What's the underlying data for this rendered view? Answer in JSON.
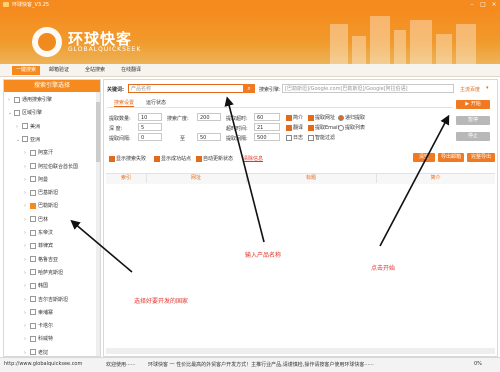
{
  "window": {
    "title": "环球快客_V3.25",
    "min": "–",
    "max": "□",
    "close": "×"
  },
  "header": {
    "logo_cn": "环球快客",
    "logo_en": "GLOBALQUICKSEEK"
  },
  "menu": [
    {
      "label": "一键搜索",
      "active": true
    },
    {
      "label": "邮箱验证",
      "active": false
    },
    {
      "label": "全站搜索",
      "active": false
    },
    {
      "label": "在线翻译",
      "active": false
    }
  ],
  "left_panel": {
    "title": "搜索引擎选择",
    "items": [
      {
        "label": "通用搜索引擎",
        "level": 0,
        "arrow": "›",
        "checked": false
      },
      {
        "label": "区域引擎",
        "level": 0,
        "arrow": "⌄",
        "checked": false
      },
      {
        "label": "美洲",
        "level": 1,
        "arrow": "›",
        "checked": false
      },
      {
        "label": "亚洲",
        "level": 1,
        "arrow": "⌄",
        "checked": false
      },
      {
        "label": "阿富汗",
        "level": 2,
        "arrow": "›",
        "checked": false
      },
      {
        "label": "阿拉伯联合酋长国",
        "level": 2,
        "arrow": "›",
        "checked": false
      },
      {
        "label": "阿曼",
        "level": 2,
        "arrow": "›",
        "checked": false
      },
      {
        "label": "巴基斯坦",
        "level": 2,
        "arrow": "›",
        "checked": false
      },
      {
        "label": "巴勒斯坦",
        "level": 2,
        "arrow": "›",
        "checked": true
      },
      {
        "label": "巴林",
        "level": 2,
        "arrow": "›",
        "checked": false
      },
      {
        "label": "东帝汶",
        "level": 2,
        "arrow": "›",
        "checked": false
      },
      {
        "label": "菲律宾",
        "level": 2,
        "arrow": "›",
        "checked": false
      },
      {
        "label": "格鲁吉亚",
        "level": 2,
        "arrow": "›",
        "checked": false
      },
      {
        "label": "哈萨克斯坦",
        "level": 2,
        "arrow": "›",
        "checked": false
      },
      {
        "label": "韩国",
        "level": 2,
        "arrow": "›",
        "checked": false
      },
      {
        "label": "吉尔吉斯斯坦",
        "level": 2,
        "arrow": "›",
        "checked": false
      },
      {
        "label": "柬埔寨",
        "level": 2,
        "arrow": "›",
        "checked": false
      },
      {
        "label": "卡塔尔",
        "level": 2,
        "arrow": "›",
        "checked": false
      },
      {
        "label": "科威特",
        "level": 2,
        "arrow": "›",
        "checked": false
      },
      {
        "label": "老挝",
        "level": 2,
        "arrow": "›",
        "checked": false
      }
    ]
  },
  "search": {
    "keyword_label": "关键词:",
    "keyword_placeholder": "产品名称",
    "engine_label": "搜索引擎:",
    "engine_value": "[巴勒斯坦]/Google.com[巴勒斯坦]/Google[阿拉伯语]",
    "domain_select": "主流百度"
  },
  "tabs": {
    "sub1": "搜索设置",
    "sub2": "运行状态"
  },
  "settings": {
    "fetch_count_label": "提取数量:",
    "fetch_count": "10",
    "search_depth_label": "搜索广度:",
    "search_depth": "200",
    "fetch_timeout_label": "提取超时:",
    "fetch_timeout": "60",
    "depth_label": "深  度:",
    "depth": "5",
    "timeout_label": "超时时间:",
    "timeout": "21",
    "thread_label": "提取间隔:",
    "thread_from": "0",
    "thread_to_label": "至",
    "thread_to": "50",
    "ms_label": "提取间隔:",
    "ms": "500"
  },
  "checks": [
    {
      "label": "简介",
      "on": true
    },
    {
      "label": "提取网址",
      "on": true
    },
    {
      "label": "翻译",
      "on": true
    },
    {
      "label": "提取Email",
      "on": true
    },
    {
      "label": "日志",
      "on": false
    },
    {
      "label": "智能过滤",
      "on": false
    }
  ],
  "radios": [
    {
      "label": "递归提取",
      "on": true
    },
    {
      "label": "提取列表",
      "on": false
    }
  ],
  "options": {
    "show_lost": "显示搜索失败",
    "show_success": "显示成功站点",
    "auto_update": "自动更新状态",
    "detail_link": "清除信息"
  },
  "buttons": {
    "start": "开始",
    "pause": "暂停",
    "stop": "停止",
    "clear": "清空",
    "export_mail": "导出邮箱",
    "export_all": "完整导出"
  },
  "table": {
    "headers": [
      "索引",
      "网址",
      "标题",
      "简介"
    ]
  },
  "annotations": {
    "country": "选择好要开发的国家",
    "product": "输入产品名称",
    "start": "点击开始"
  },
  "status": {
    "url": "http://www.globalquicksee.com",
    "welcome": "欢迎使用······",
    "marquee": "环球快客 一 性价比最高的外贸客户开发方式！主推行业产品,请谨慎检,操作请按客户使用环球快客······",
    "percent": "0%"
  }
}
